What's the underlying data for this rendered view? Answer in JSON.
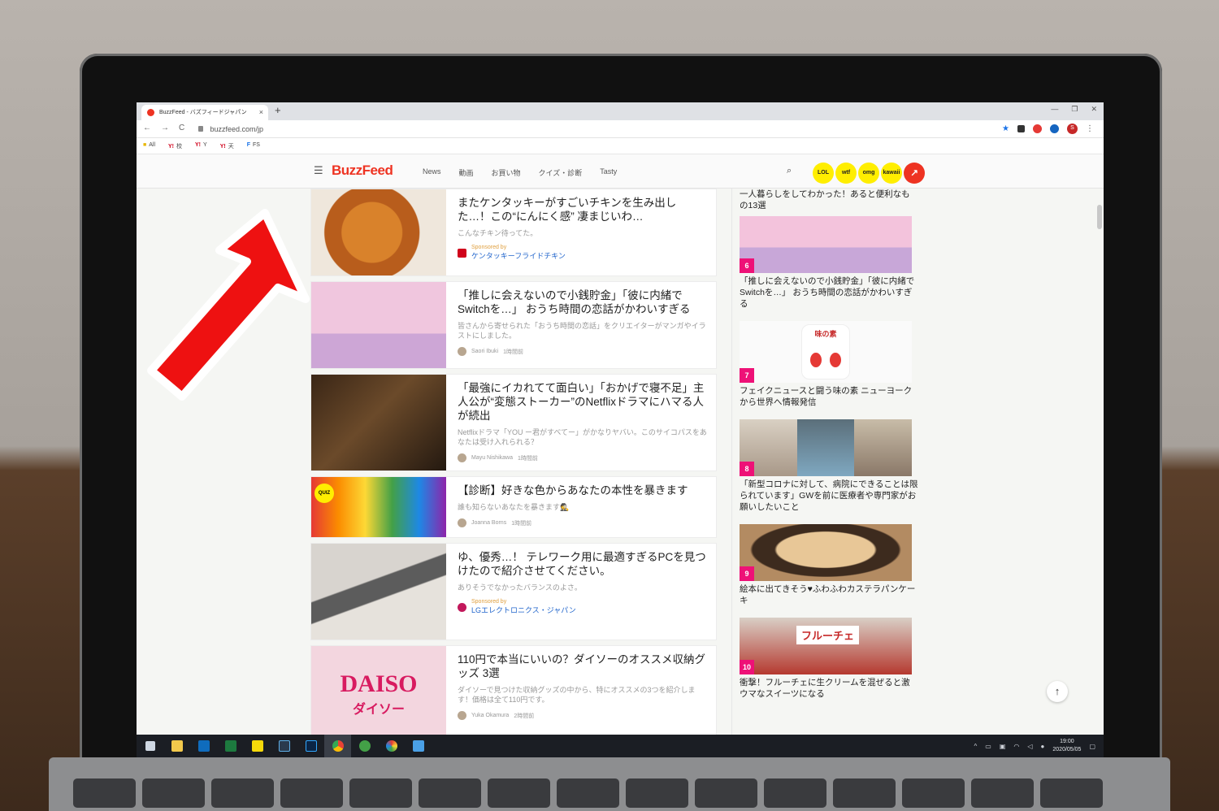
{
  "browser": {
    "tab_title": "BuzzFeed - バズフィードジャパン",
    "tab_close": "×",
    "new_tab": "+",
    "url": "buzzfeed.com/jp",
    "window_controls": [
      "—",
      "❐",
      "✕"
    ],
    "nav_icons": [
      "←",
      "→",
      "C"
    ],
    "bookmarks": [
      {
        "icon": "",
        "label": "All"
      },
      {
        "icon": "Y!",
        "label": "校"
      },
      {
        "icon": "Y!",
        "label": "Y"
      },
      {
        "icon": "Y!",
        "label": "天"
      },
      {
        "icon": "F",
        "label": "FS"
      }
    ],
    "profile_initial": "S"
  },
  "site": {
    "logo": "BuzzFeed",
    "menu": [
      "News",
      "動画",
      "お買い物",
      "クイズ・診断",
      "Tasty"
    ],
    "badges": [
      "LOL",
      "wtf",
      "omg",
      "kawaii"
    ],
    "trend_icon": "↗"
  },
  "feed": [
    {
      "title": "またケンタッキーがすごいチキンを生み出した…！この“にんにく感” 凄まじいわ…",
      "desc": "こんなチキン待ってた。",
      "sponsored_label": "Sponsored by",
      "sponsor": "ケンタッキーフライドチキン"
    },
    {
      "title": "「推しに会えないので小銭貯金」「彼に内緒でSwitchを…」 おうち時間の恋話がかわいすぎる",
      "desc": "皆さんから寄せられた「おうち時間の恋話」をクリエイターがマンガやイラストにしました。",
      "author": "Saori Ibuki",
      "time": "1時間前"
    },
    {
      "title": "「最強にイカれてて面白い」「おかげで寝不足」主人公が“変態ストーカー”のNetflixドラマにハマる人が続出",
      "desc": "Netflixドラマ「YOU ー君がすべてー」がかなりヤバい。このサイコパスをあなたは受け入れられる？",
      "author": "Mayu Nishikawa",
      "time": "1時間前"
    },
    {
      "title": "【診断】好きな色からあなたの本性を暴きます",
      "desc": "誰も知らないあなたを暴きます🕵",
      "author": "Joanna Borns",
      "time": "1時間前",
      "quiz": "QUIZ"
    },
    {
      "title": "ゆ、優秀…！ テレワーク用に最適すぎるPCを見つけたので紹介させてください。",
      "desc": "ありそうでなかったバランスのよさ。",
      "sponsored_label": "Sponsored by",
      "sponsor": "LGエレクトロニクス・ジャパン"
    },
    {
      "title": "110円で本当にいいの？ダイソーのオススメ収納グッズ 3選",
      "desc": "ダイソーで見つけた収納グッズの中から、特にオススメの3つを紹介します！価格は全て110円です。",
      "author": "Yuka Okamura",
      "time": "2時間前",
      "thumb_text": "DAISO",
      "thumb_sub": "ダイソー"
    }
  ],
  "sidebar": {
    "top_title": "一人暮らしをしてわかった！あると便利なもの13選",
    "items": [
      {
        "rank": "6",
        "title": "「推しに会えないので小銭貯金」「彼に内緒でSwitchを…」 おうち時間の恋話がかわいすぎる"
      },
      {
        "rank": "7",
        "title": "フェイクニュースと闘う味の素 ニューヨークから世界へ情報発信",
        "thumb_text": "味の素"
      },
      {
        "rank": "8",
        "title": "「新型コロナに対して、病院にできることは限られています」GWを前に医療者や専門家がお願いしたいこと"
      },
      {
        "rank": "9",
        "title": "絵本に出てきそう♥ふわふわカステラパンケーキ"
      },
      {
        "rank": "10",
        "title": "衝撃！フルーチェに生クリームを混ぜると激ウマなスイーツになる",
        "thumb_text": "フルーチェ"
      }
    ]
  },
  "scroll_top": "↑",
  "taskbar": {
    "time": "19:00",
    "date": "2020/05/05"
  }
}
